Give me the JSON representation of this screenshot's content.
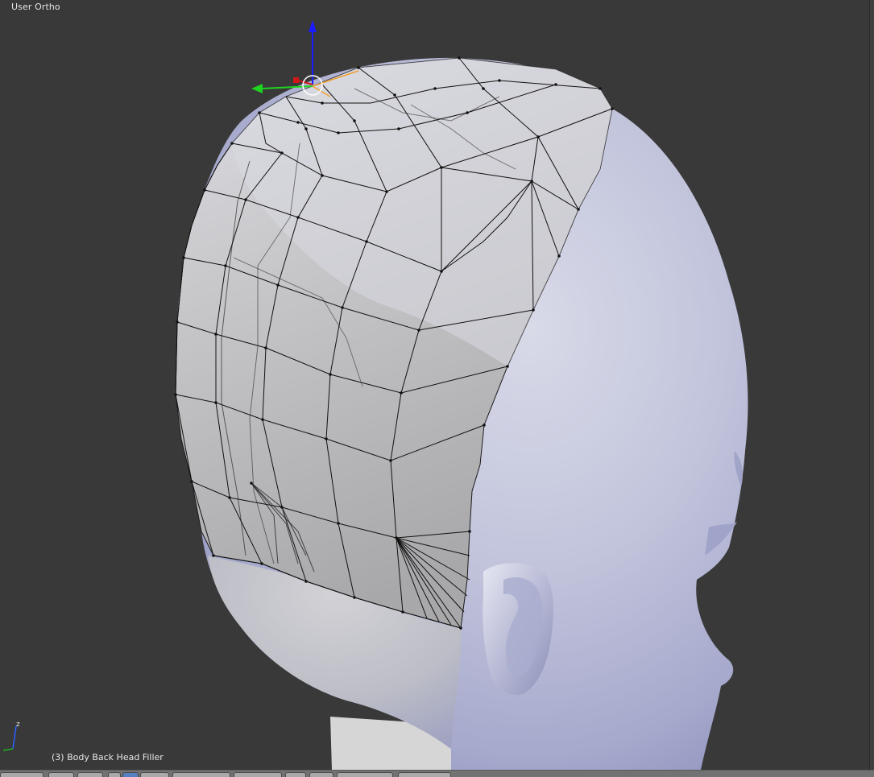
{
  "viewport": {
    "view_label": "User Ortho",
    "object_label": "(3) Body Back Head Filler"
  },
  "gizmo": {
    "z_axis_color": "#1b1bff",
    "y_axis_color": "#1fd21f",
    "x_axis_color": "#d01818"
  },
  "mini_axis": {
    "z_label": "z",
    "z_color": "#2a62ff",
    "y_color": "#20b020"
  },
  "mesh": {
    "body_color": "#c7c9e0",
    "edit_face_color": "#c4c4c6",
    "wire_color": "#000000",
    "selected_edge_color": "#f0a030"
  },
  "header": {
    "buttons": [
      "view-menu",
      "select-menu",
      "add-menu",
      "mesh-menu",
      "mode-select",
      "shading",
      "pivot",
      "manipulator",
      "layers",
      "snap",
      "proportional"
    ]
  }
}
